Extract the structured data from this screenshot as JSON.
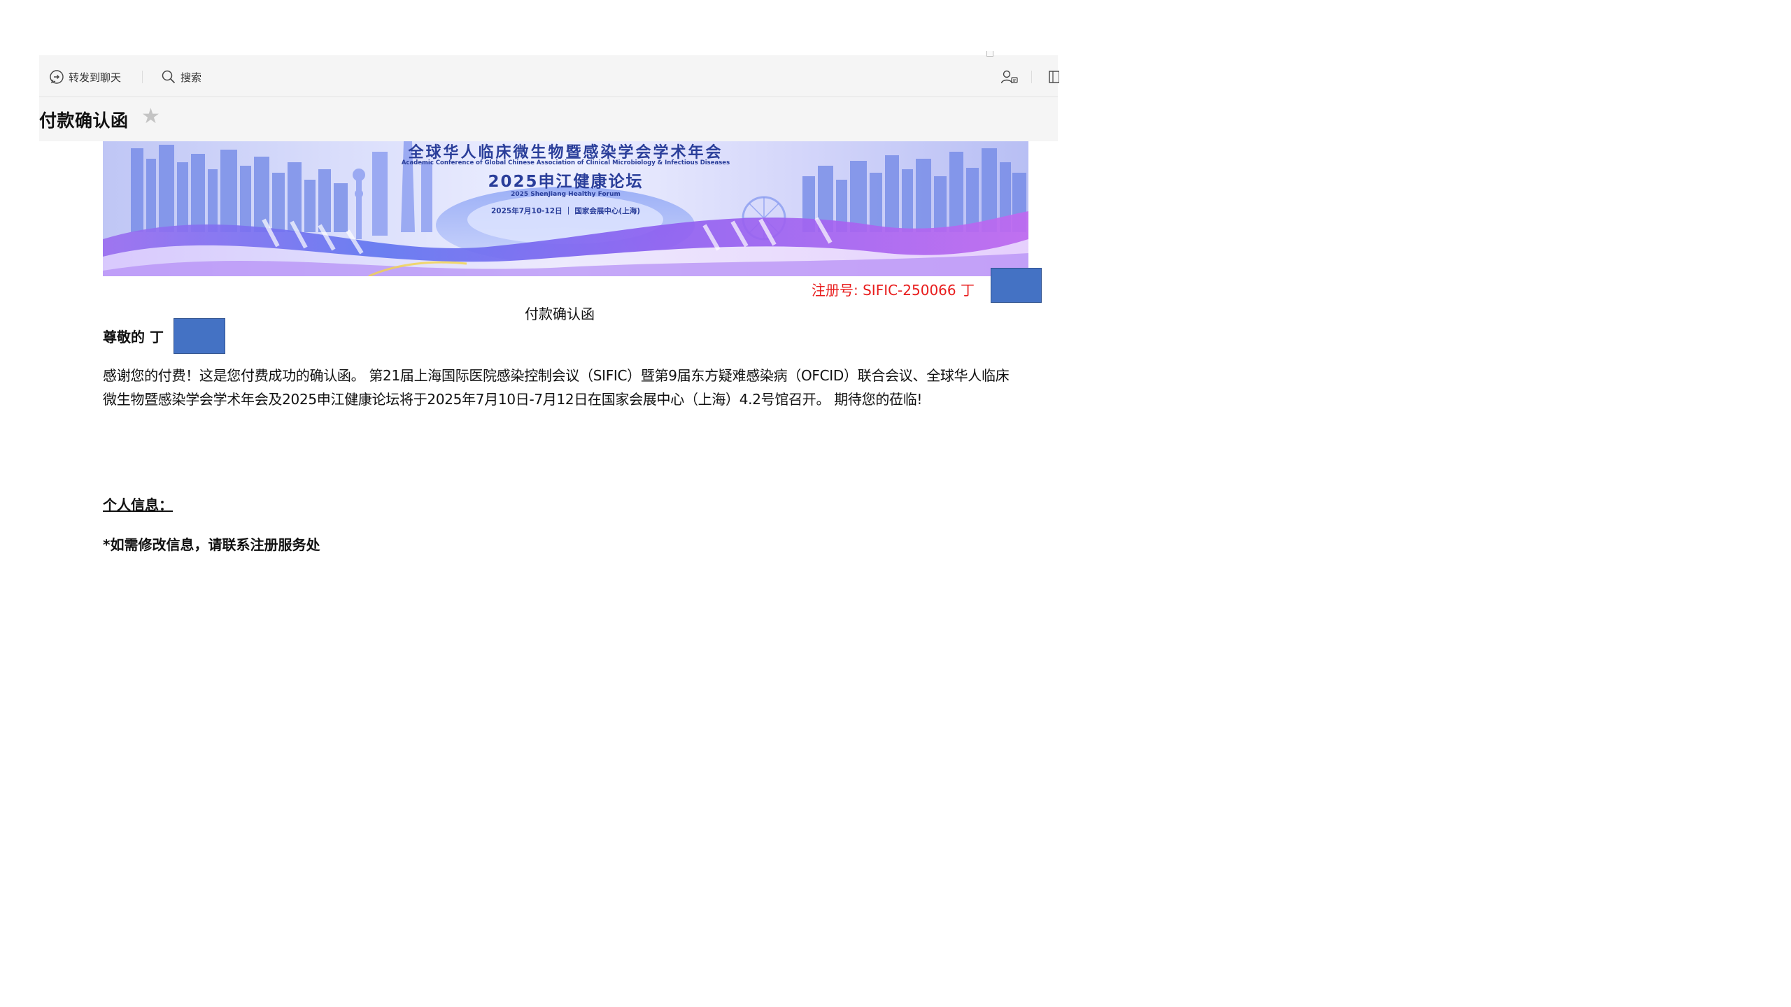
{
  "toolbar": {
    "forward_label": "转发到聊天",
    "search_label": "搜索"
  },
  "email": {
    "subject": "付款确认函",
    "star_glyph": "★"
  },
  "banner": {
    "title_cn": "全球华人临床微生物暨感染学会学术年会",
    "title_en": "Academic Conference of Global Chinese Association of Clinical Microbiology & Infectious Diseases",
    "forum_cn": "2025申江健康论坛",
    "forum_en": "2025 ShenJiang Healthy Forum",
    "date_venue": "2025年7月10-12日 ｜ 国家会展中心(上海)"
  },
  "letter": {
    "registration_no": "注册号: SIFIC-250066 丁",
    "doc_title": "付款确认函",
    "greeting": "尊敬的 丁",
    "body": "感谢您的付费！这是您付费成功的确认函。 第21届上海国际医院感染控制会议（SIFIC）暨第9届东方疑难感染病（OFCID）联合会议、全球华人临床微生物暨感染学会学术年会及2025申江健康论坛将于2025年7月10日-7月12日在国家会展中心（上海）4.2号馆召开。 期待您的莅临!",
    "section_personal": "个人信息：",
    "note": "*如需修改信息，请联系注册服务处"
  },
  "colors": {
    "redaction": "#4472c4",
    "registration_text": "#e81c1c",
    "banner_text": "#2a3e9a"
  },
  "icons": [
    "forward-chat-icon",
    "search-icon",
    "contact-card-icon",
    "layout-panel-icon",
    "star-icon"
  ]
}
